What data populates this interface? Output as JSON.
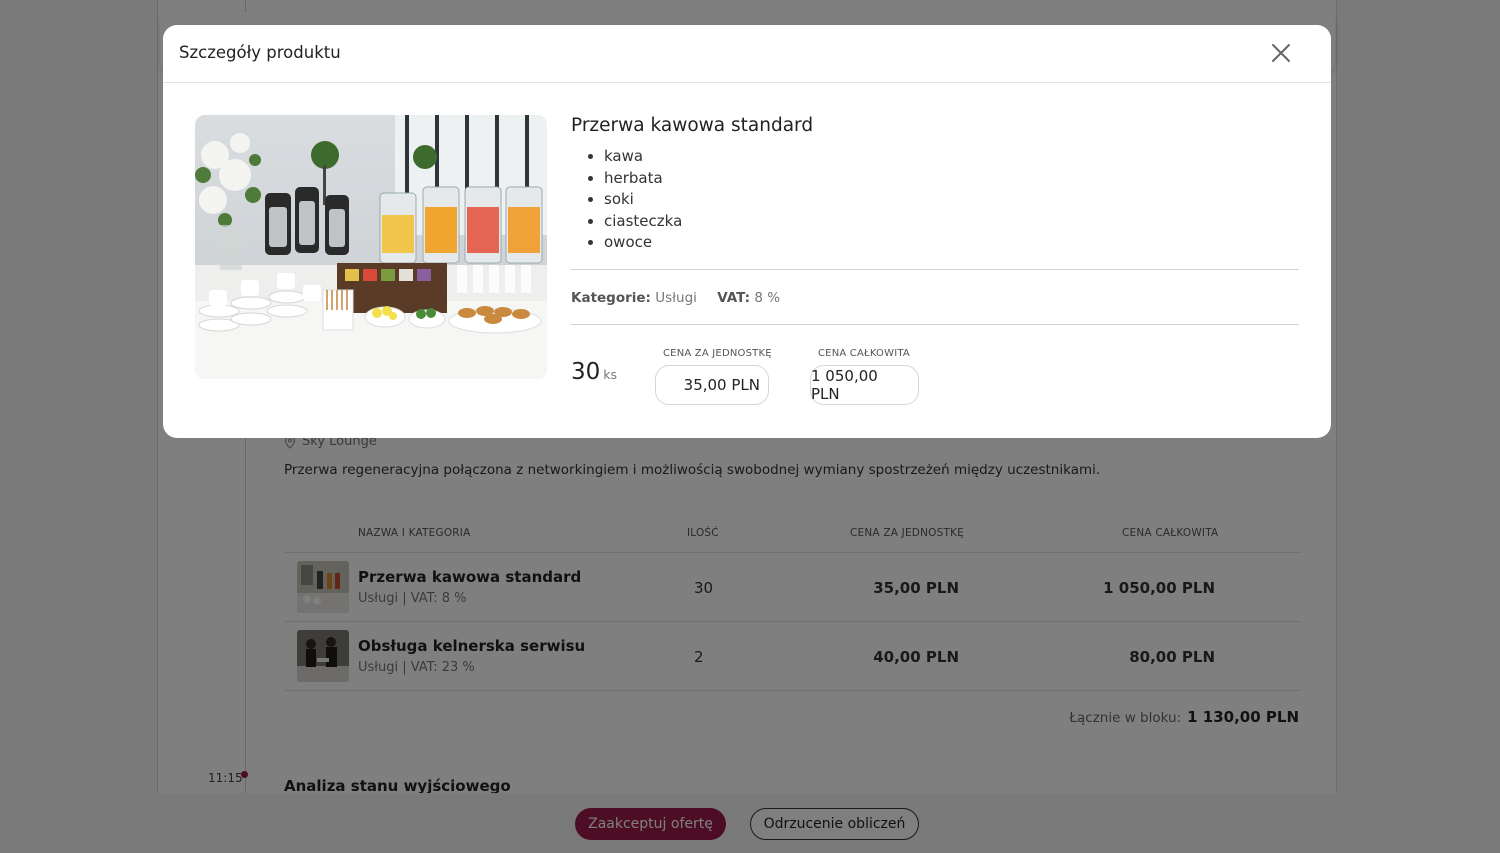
{
  "background": {
    "location": "Sky Lounge",
    "description": "Przerwa regeneracyjna połączona z networkingiem i możliwością swobodnej wymiany spostrzeżeń między uczestnikami.",
    "table": {
      "headers": {
        "name": "NAZWA I KATEGORIA",
        "qty": "ILOŚĆ",
        "unit_price": "CENA ZA JEDNOSTKĘ",
        "total": "CENA CAŁKOWITA"
      },
      "rows": [
        {
          "name": "Przerwa kawowa standard",
          "sub": "Usługi |  VAT: 8 %",
          "qty": "30",
          "unit_price": "35,00 PLN",
          "total": "1 050,00 PLN"
        },
        {
          "name": "Obsługa kelnerska serwisu",
          "sub": "Usługi |  VAT: 23 %",
          "qty": "2",
          "unit_price": "40,00 PLN",
          "total": "80,00 PLN"
        }
      ]
    },
    "block_total_label": "Łącznie w bloku:",
    "block_total_value": "1 130,00 PLN",
    "next_time": "11:15",
    "next_title": "Analiza stanu wyjściowego",
    "accept_label": "Zaakceptuj ofertę",
    "reject_label": "Odrzucenie obliczeń"
  },
  "modal": {
    "title": "Szczegóły produktu",
    "product_name": "Przerwa kawowa standard",
    "items": [
      "kawa",
      "herbata",
      "soki",
      "ciasteczka",
      "owoce"
    ],
    "category_label": "Kategorie:",
    "category_value": "Usługi",
    "vat_label": "VAT:",
    "vat_value": "8 %",
    "quantity": "30",
    "quantity_unit": "ks",
    "unit_price_label": "CENA ZA JEDNOSTKĘ",
    "unit_price_value": "35,00 PLN",
    "total_price_label": "CENA CAŁKOWITA",
    "total_price_value": "1 050,00 PLN"
  },
  "colors": {
    "accent": "#9b1b4a",
    "overlay": "rgba(0,0,0,0.5)"
  }
}
